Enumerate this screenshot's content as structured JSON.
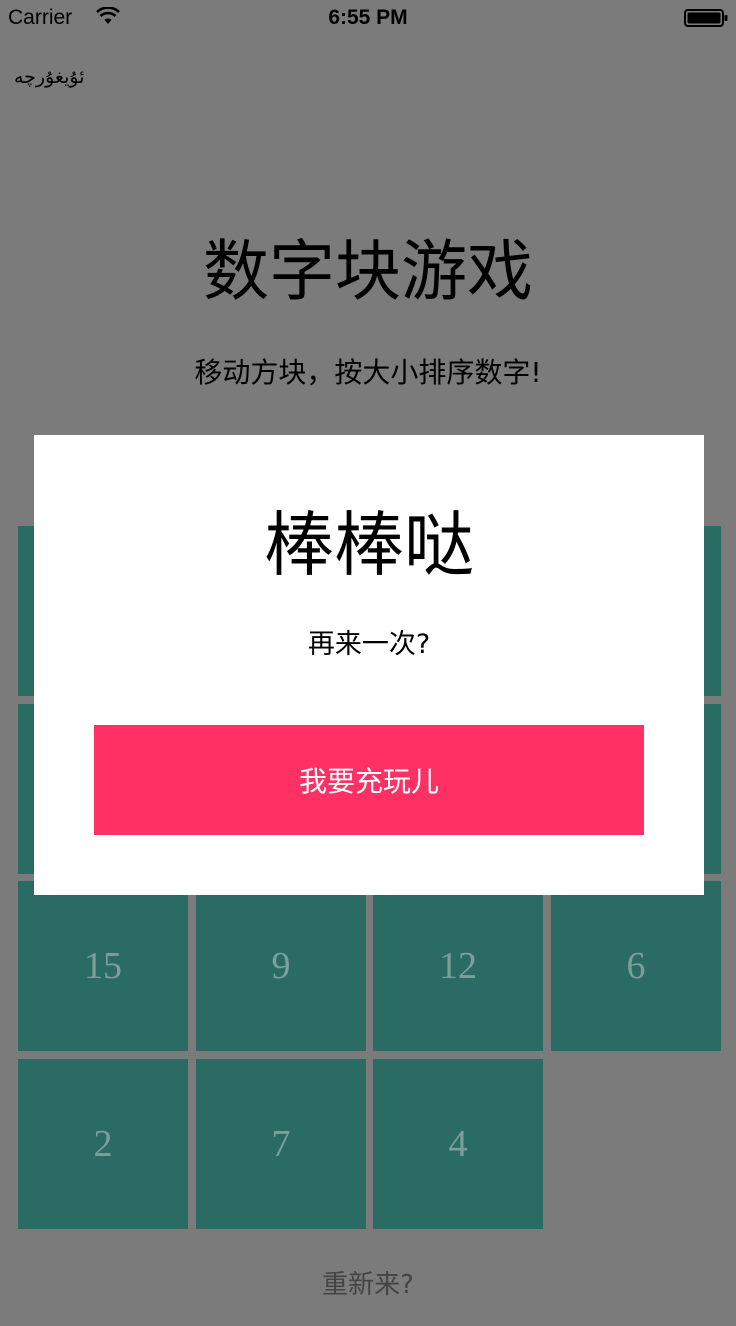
{
  "status_bar": {
    "carrier": "Carrier",
    "time": "6:55 PM",
    "icons": [
      "wifi-icon",
      "battery-icon"
    ]
  },
  "header": {
    "language_link": "ئۇيغۇرچە",
    "title": "数字块游戏",
    "subtitle": "移动方块，按大小排序数字!"
  },
  "board": {
    "tiles": [
      {
        "label": "15"
      },
      {
        "label": "9"
      },
      {
        "label": "12"
      },
      {
        "label": "6"
      },
      {
        "label": "2"
      },
      {
        "label": "7"
      },
      {
        "label": "4"
      }
    ],
    "tile_color": "#2a6b63"
  },
  "restart_label": "重新来?",
  "modal": {
    "title": "棒棒哒",
    "message": "再来一次?",
    "button_label": "我要充玩儿",
    "button_color": "#ff3064"
  }
}
